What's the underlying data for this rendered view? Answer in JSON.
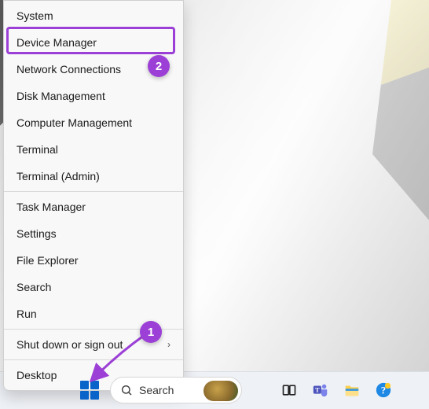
{
  "context_menu": {
    "items": [
      {
        "label": "System"
      },
      {
        "label": "Device Manager"
      },
      {
        "label": "Network Connections"
      },
      {
        "label": "Disk Management"
      },
      {
        "label": "Computer Management"
      },
      {
        "label": "Terminal"
      },
      {
        "label": "Terminal (Admin)"
      },
      {
        "label": "Task Manager"
      },
      {
        "label": "Settings"
      },
      {
        "label": "File Explorer"
      },
      {
        "label": "Search"
      },
      {
        "label": "Run"
      },
      {
        "label": "Shut down or sign out",
        "submenu": true
      },
      {
        "label": "Desktop"
      }
    ],
    "highlighted_index": 1
  },
  "taskbar": {
    "search_placeholder": "Search",
    "icons": {
      "start": "start-icon",
      "search": "search-icon",
      "taskview": "task-view-icon",
      "teams": "teams-icon",
      "explorer": "file-explorer-icon",
      "tips": "tips-icon"
    }
  },
  "annotations": {
    "badge1": "1",
    "badge2": "2"
  }
}
